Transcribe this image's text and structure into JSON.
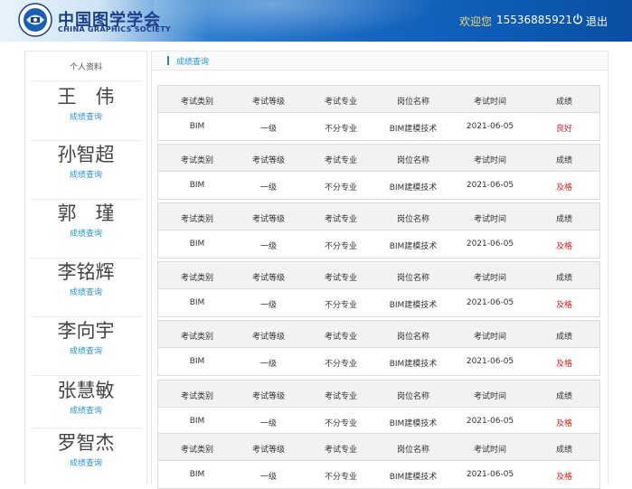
{
  "header": {
    "logo_cn": "中国图学学会",
    "logo_en": "CHINA GRAPHICS SOCIETY",
    "welcome": "欢迎您",
    "phone": "15536885921",
    "logout_label": "退出",
    "icons": [
      "society-emblem-icon",
      "power-icon"
    ],
    "colors": {
      "header_blue": "#1565c0",
      "welcome_text": "#f3d96a"
    }
  },
  "sidebar": {
    "title": "个人资料",
    "link_color": "#2a95d0",
    "people": [
      {
        "name": "王　伟",
        "link": "成绩查询"
      },
      {
        "name": "孙智超",
        "link": "成绩查询"
      },
      {
        "name": "郭　瑾",
        "link": "成绩查询"
      },
      {
        "name": "李铭辉",
        "link": "成绩查询"
      },
      {
        "name": "李向宇",
        "link": "成绩查询"
      },
      {
        "name": "张慧敏",
        "link": "成绩查询"
      },
      {
        "name": "罗智杰",
        "link": "成绩查询"
      }
    ]
  },
  "main": {
    "section_title": "成绩查询",
    "columns": [
      "考试类别",
      "考试等级",
      "考试专业",
      "岗位名称",
      "考试时间",
      "成绩"
    ],
    "grade_color": "#e02020",
    "records": [
      {
        "category": "BIM",
        "level": "一级",
        "major": "不分专业",
        "position": "BIM建模技术",
        "date": "2021-06-05",
        "grade": "良好"
      },
      {
        "category": "BIM",
        "level": "一级",
        "major": "不分专业",
        "position": "BIM建模技术",
        "date": "2021-06-05",
        "grade": "及格"
      },
      {
        "category": "BIM",
        "level": "一级",
        "major": "不分专业",
        "position": "BIM建模技术",
        "date": "2021-06-05",
        "grade": "及格"
      },
      {
        "category": "BIM",
        "level": "一级",
        "major": "不分专业",
        "position": "BIM建模技术",
        "date": "2021-06-05",
        "grade": "及格"
      },
      {
        "category": "BIM",
        "level": "一级",
        "major": "不分专业",
        "position": "BIM建模技术",
        "date": "2021-06-05",
        "grade": "及格"
      },
      {
        "category": "BIM",
        "level": "一级",
        "major": "不分专业",
        "position": "BIM建模技术",
        "date": "2021-06-05",
        "grade": "及格"
      },
      {
        "category": "BIM",
        "level": "一级",
        "major": "不分专业",
        "position": "BIM建模技术",
        "date": "2021-06-05",
        "grade": "及格"
      }
    ]
  }
}
